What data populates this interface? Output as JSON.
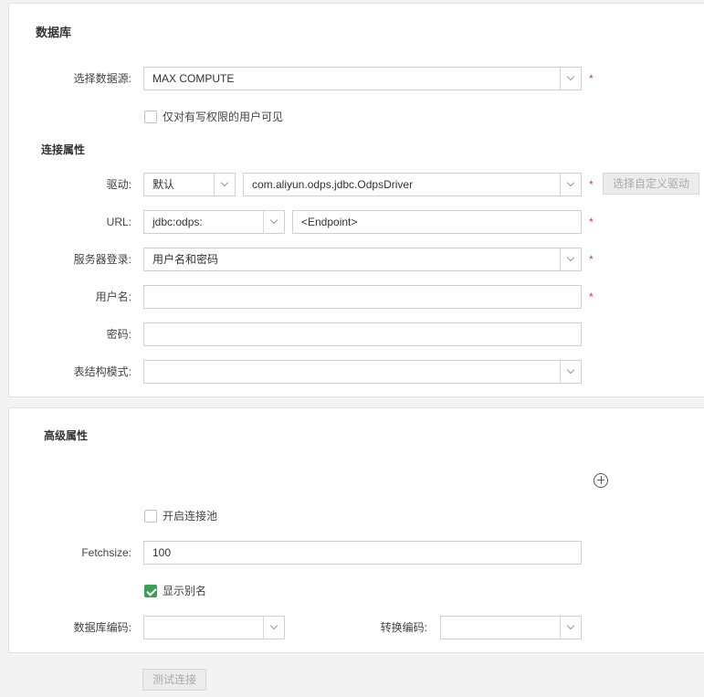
{
  "database_section": {
    "title": "数据库",
    "datasource": {
      "label": "选择数据源:",
      "value": "MAX COMPUTE"
    },
    "write_only_checkbox": {
      "label": "仅对有写权限的用户可见",
      "checked": false
    },
    "connection": {
      "title": "连接属性",
      "driver": {
        "label": "驱动:",
        "type_value": "默认",
        "class_value": "com.aliyun.odps.jdbc.OdpsDriver",
        "custom_button": "选择自定义驱动"
      },
      "url": {
        "label": "URL:",
        "prefix_value": "jdbc:odps:",
        "endpoint_value": "<Endpoint>"
      },
      "server_login": {
        "label": "服务器登录:",
        "value": "用户名和密码"
      },
      "username": {
        "label": "用户名:",
        "value": ""
      },
      "password": {
        "label": "密码:",
        "value": ""
      },
      "schema_mode": {
        "label": "表结构模式:",
        "value": ""
      }
    },
    "required_mark": "*"
  },
  "advanced_section": {
    "title": "高级属性",
    "connection_pool": {
      "label": "开启连接池",
      "checked": false
    },
    "fetchsize": {
      "label": "Fetchsize:",
      "value": "100"
    },
    "show_alias": {
      "label": "显示别名",
      "checked": true
    },
    "db_encoding": {
      "label": "数据库编码:",
      "value": ""
    },
    "convert_encoding": {
      "label": "转换编码:",
      "value": ""
    }
  },
  "footer": {
    "test_button": "测试连接"
  },
  "colors": {
    "accent_green": "#3aa055",
    "required_red": "#e53935"
  }
}
